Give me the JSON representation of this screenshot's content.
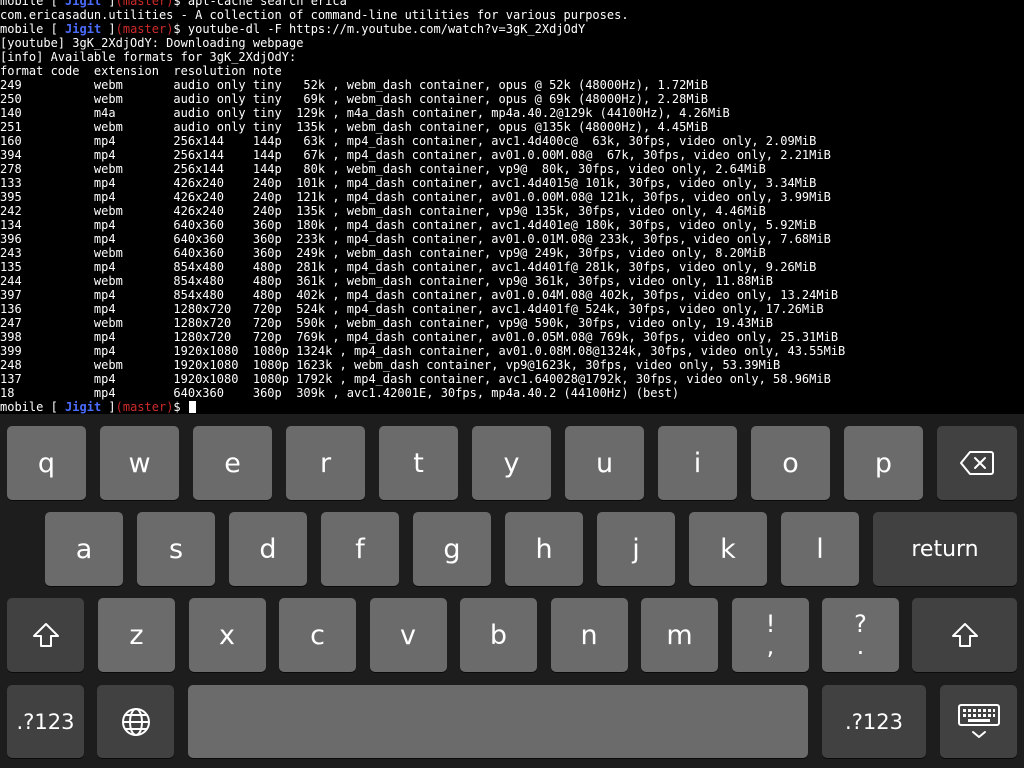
{
  "terminal": {
    "prompt": {
      "user": "mobile",
      "open": " [ ",
      "host": "Jigit",
      "close": " ]",
      "branch": "(master)",
      "symbol": "$ "
    },
    "lines": [
      {
        "type": "prompt",
        "cmd": "apt-cache search erica"
      },
      {
        "type": "out",
        "text": "com.ericasadun.utilities - A collection of command-line utilities for various purposes."
      },
      {
        "type": "prompt",
        "cmd": "youtube-dl -F https://m.youtube.com/watch?v=3gK_2XdjOdY"
      },
      {
        "type": "out",
        "text": "[youtube] 3gK_2XdjOdY: Downloading webpage"
      },
      {
        "type": "out",
        "text": "[info] Available formats for 3gK_2XdjOdY:"
      },
      {
        "type": "out",
        "text": "format code  extension  resolution note"
      },
      {
        "type": "out",
        "text": "249          webm       audio only tiny   52k , webm_dash container, opus @ 52k (48000Hz), 1.72MiB"
      },
      {
        "type": "out",
        "text": "250          webm       audio only tiny   69k , webm_dash container, opus @ 69k (48000Hz), 2.28MiB"
      },
      {
        "type": "out",
        "text": "140          m4a        audio only tiny  129k , m4a_dash container, mp4a.40.2@129k (44100Hz), 4.26MiB"
      },
      {
        "type": "out",
        "text": "251          webm       audio only tiny  135k , webm_dash container, opus @135k (48000Hz), 4.45MiB"
      },
      {
        "type": "out",
        "text": "160          mp4        256x144    144p   63k , mp4_dash container, avc1.4d400c@  63k, 30fps, video only, 2.09MiB"
      },
      {
        "type": "out",
        "text": "394          mp4        256x144    144p   67k , mp4_dash container, av01.0.00M.08@  67k, 30fps, video only, 2.21MiB"
      },
      {
        "type": "out",
        "text": "278          webm       256x144    144p   80k , webm_dash container, vp9@  80k, 30fps, video only, 2.64MiB"
      },
      {
        "type": "out",
        "text": "133          mp4        426x240    240p  101k , mp4_dash container, avc1.4d4015@ 101k, 30fps, video only, 3.34MiB"
      },
      {
        "type": "out",
        "text": "395          mp4        426x240    240p  121k , mp4_dash container, av01.0.00M.08@ 121k, 30fps, video only, 3.99MiB"
      },
      {
        "type": "out",
        "text": "242          webm       426x240    240p  135k , webm_dash container, vp9@ 135k, 30fps, video only, 4.46MiB"
      },
      {
        "type": "out",
        "text": "134          mp4        640x360    360p  180k , mp4_dash container, avc1.4d401e@ 180k, 30fps, video only, 5.92MiB"
      },
      {
        "type": "out",
        "text": "396          mp4        640x360    360p  233k , mp4_dash container, av01.0.01M.08@ 233k, 30fps, video only, 7.68MiB"
      },
      {
        "type": "out",
        "text": "243          webm       640x360    360p  249k , webm_dash container, vp9@ 249k, 30fps, video only, 8.20MiB"
      },
      {
        "type": "out",
        "text": "135          mp4        854x480    480p  281k , mp4_dash container, avc1.4d401f@ 281k, 30fps, video only, 9.26MiB"
      },
      {
        "type": "out",
        "text": "244          webm       854x480    480p  361k , webm_dash container, vp9@ 361k, 30fps, video only, 11.88MiB"
      },
      {
        "type": "out",
        "text": "397          mp4        854x480    480p  402k , mp4_dash container, av01.0.04M.08@ 402k, 30fps, video only, 13.24MiB"
      },
      {
        "type": "out",
        "text": "136          mp4        1280x720   720p  524k , mp4_dash container, avc1.4d401f@ 524k, 30fps, video only, 17.26MiB"
      },
      {
        "type": "out",
        "text": "247          webm       1280x720   720p  590k , webm_dash container, vp9@ 590k, 30fps, video only, 19.43MiB"
      },
      {
        "type": "out",
        "text": "398          mp4        1280x720   720p  769k , mp4_dash container, av01.0.05M.08@ 769k, 30fps, video only, 25.31MiB"
      },
      {
        "type": "out",
        "text": "399          mp4        1920x1080  1080p 1324k , mp4_dash container, av01.0.08M.08@1324k, 30fps, video only, 43.55MiB"
      },
      {
        "type": "out",
        "text": "248          webm       1920x1080  1080p 1623k , webm_dash container, vp9@1623k, 30fps, video only, 53.39MiB"
      },
      {
        "type": "out",
        "text": "137          mp4        1920x1080  1080p 1792k , mp4_dash container, avc1.640028@1792k, 30fps, video only, 58.96MiB"
      },
      {
        "type": "out",
        "text": "18           mp4        640x360    360p  309k , avc1.42001E, 30fps, mp4a.40.2 (44100Hz) (best)"
      },
      {
        "type": "prompt",
        "cmd": "",
        "cursor": true
      }
    ]
  },
  "keyboard": {
    "colors": {
      "background": "#1d1d1d",
      "letter_key": "#6b6b6b",
      "function_key": "#414141",
      "text": "#ffffff"
    },
    "row1": [
      "q",
      "w",
      "e",
      "r",
      "t",
      "y",
      "u",
      "i",
      "o",
      "p"
    ],
    "row2": [
      "a",
      "s",
      "d",
      "f",
      "g",
      "h",
      "j",
      "k",
      "l"
    ],
    "row3": [
      "z",
      "x",
      "c",
      "v",
      "b",
      "n",
      "m"
    ],
    "punct1": {
      "top": "!",
      "bottom": ","
    },
    "punct2": {
      "top": "?",
      "bottom": "."
    },
    "return_label": "return",
    "numbers_label": ".?123",
    "icons": {
      "delete": "delete-icon",
      "shift": "shift-icon",
      "globe": "globe-icon",
      "dismiss": "keyboard-dismiss-icon"
    }
  }
}
